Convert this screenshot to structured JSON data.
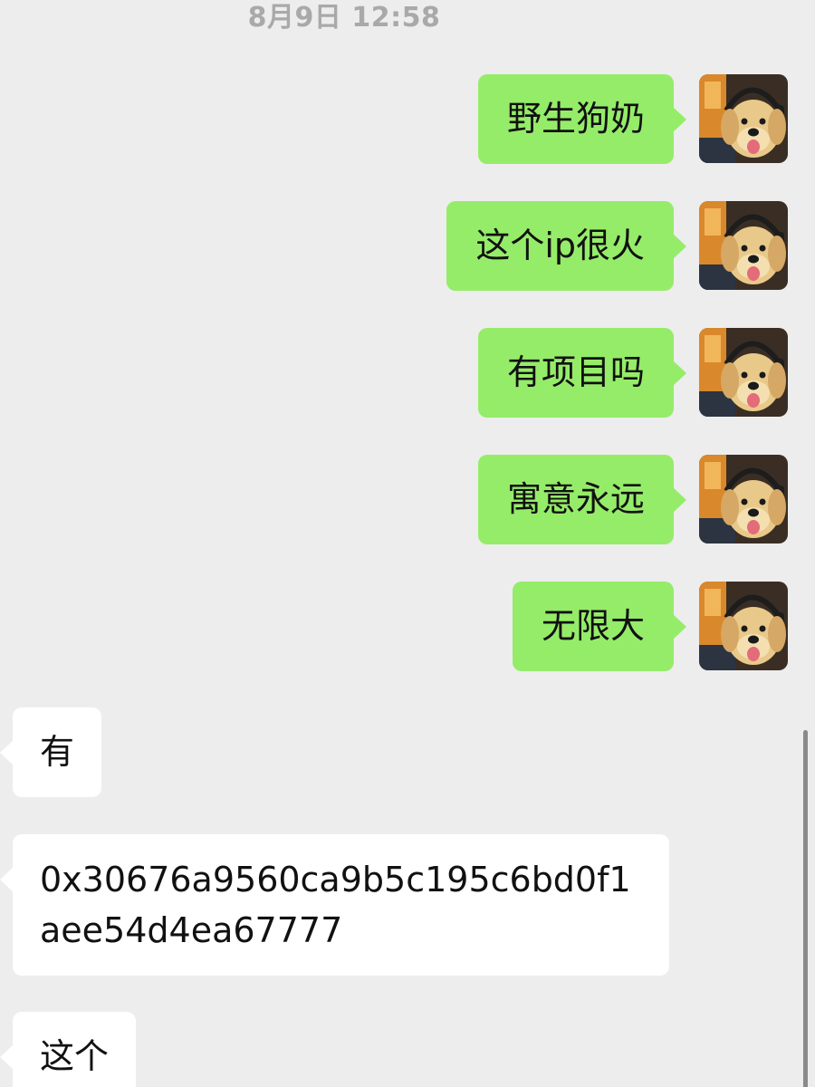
{
  "timestamp": "8月9日 12:58",
  "avatar": {
    "icon": "puppy-avatar",
    "colors": {
      "background": "#3a2e24",
      "fur": "#e9c98a",
      "fur_light": "#f4dfb0",
      "headphones": "#1d1d1d",
      "poster": "#d9882b",
      "tongue": "#e46b7a"
    }
  },
  "messages": [
    {
      "side": "out",
      "text": "野生狗奶"
    },
    {
      "side": "out",
      "text": "这个ip很火"
    },
    {
      "side": "out",
      "text": "有项目吗"
    },
    {
      "side": "out",
      "text": "寓意永远"
    },
    {
      "side": "out",
      "text": "无限大"
    },
    {
      "side": "in",
      "text": "有"
    },
    {
      "side": "in",
      "text": "0x30676a9560ca9b5c195c6bd0f1aee54d4ea67777"
    },
    {
      "side": "in",
      "text": "这个"
    }
  ],
  "colors": {
    "background": "#ededed",
    "outgoing_bubble": "#95ec69",
    "incoming_bubble": "#ffffff",
    "timestamp_text": "#a9a9a9"
  }
}
